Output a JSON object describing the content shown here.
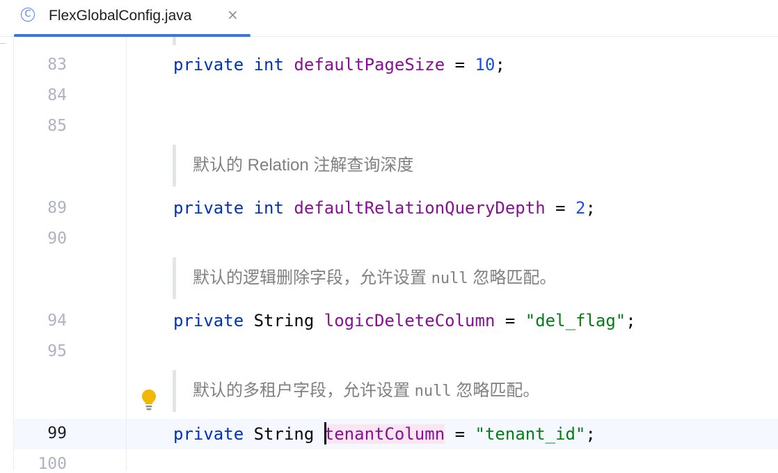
{
  "tab": {
    "icon": "class-c-icon",
    "icon_glyph": "C",
    "title": "FlexGlobalConfig.java",
    "close_glyph": "×",
    "accent": "#3574f0"
  },
  "lines": {
    "l83": "83",
    "l84": "84",
    "l85": "85",
    "l89": "89",
    "l90": "90",
    "l94": "94",
    "l95": "95",
    "l99": "99",
    "l100": "100"
  },
  "code": {
    "line83": {
      "kw1": "private",
      "kw2": "int",
      "field": "defaultPageSize",
      "eq": " = ",
      "value": "10",
      "end": ";"
    },
    "doc1": "默认的 Relation 注解查询深度",
    "line89": {
      "kw1": "private",
      "kw2": "int",
      "field": "defaultRelationQueryDepth",
      "eq": " = ",
      "value": "2",
      "end": ";"
    },
    "doc2": {
      "pre": "默认的逻辑删除字段，允许设置 ",
      "code": "null",
      "post": " 忽略匹配。"
    },
    "line94": {
      "kw1": "private",
      "type": "String",
      "field": "logicDeleteColumn",
      "eq": " = ",
      "value": "\"del_flag\"",
      "end": ";"
    },
    "doc3": {
      "pre": "默认的多租户字段，允许设置 ",
      "code": "null",
      "post": " 忽略匹配。"
    },
    "line99": {
      "kw1": "private",
      "type": "String",
      "field": "tenantColumn",
      "eq": " = ",
      "value": "\"tenant_id\"",
      "end": ";"
    }
  },
  "intention_icon": "lightbulb-icon",
  "colors": {
    "keyword": "#0033b3",
    "field": "#871094",
    "number": "#1750eb",
    "string": "#067d17",
    "doc": "#808080"
  }
}
